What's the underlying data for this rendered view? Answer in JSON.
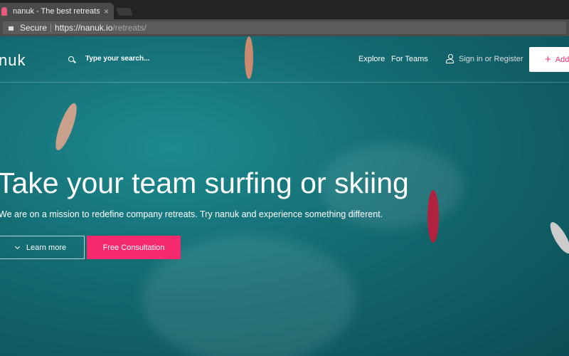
{
  "browser": {
    "tab_title": "nanuk - The best retreats and",
    "secure_label": "Secure",
    "url_host": "https://nanuk.io",
    "url_path": "/retreats/"
  },
  "nav": {
    "logo": "nuk",
    "search_placeholder": "Type your search...",
    "explore": "Explore",
    "for_teams": "For Teams",
    "sign_in": "Sign in or Register",
    "add_label": "Add"
  },
  "hero": {
    "title": "Take your team surfing or skiing",
    "subtitle": "We are on a mission to redefine company retreats. Try nanuk and experience something different.",
    "learn_more": "Learn more",
    "consultation": "Free Consultation"
  },
  "colors": {
    "accent": "#f52a6e",
    "water": "#136a70"
  }
}
